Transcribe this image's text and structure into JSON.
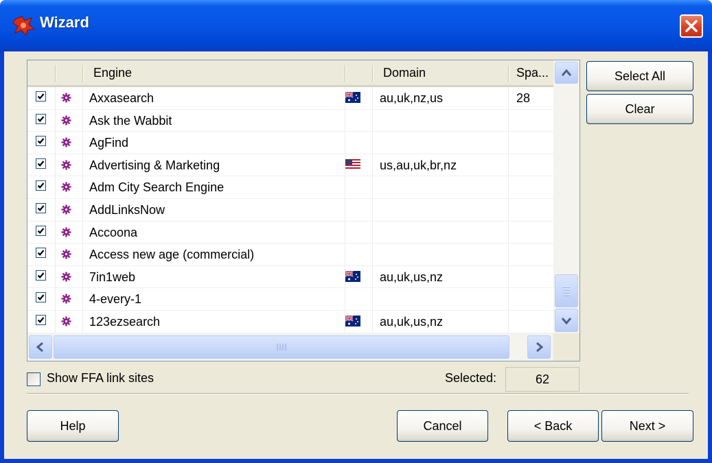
{
  "window": {
    "title": "Wizard",
    "accent_color": "#0054e3",
    "close_icon": "close-icon"
  },
  "list": {
    "columns": [
      "",
      "",
      "Engine",
      "",
      "Domain",
      "Spa..."
    ],
    "rows": [
      {
        "checked": true,
        "engine": "Axxasearch",
        "flag": "australia",
        "domain": "au,uk,nz,us",
        "spam": "28"
      },
      {
        "checked": true,
        "engine": "Ask the Wabbit",
        "flag": "",
        "domain": "",
        "spam": ""
      },
      {
        "checked": true,
        "engine": "AgFind",
        "flag": "",
        "domain": "",
        "spam": ""
      },
      {
        "checked": true,
        "engine": "Advertising & Marketing",
        "flag": "usa",
        "domain": "us,au,uk,br,nz",
        "spam": ""
      },
      {
        "checked": true,
        "engine": "Adm City Search Engine",
        "flag": "",
        "domain": "",
        "spam": ""
      },
      {
        "checked": true,
        "engine": "AddLinksNow",
        "flag": "",
        "domain": "",
        "spam": ""
      },
      {
        "checked": true,
        "engine": "Accoona",
        "flag": "",
        "domain": "",
        "spam": ""
      },
      {
        "checked": true,
        "engine": "Access new age (commercial)",
        "flag": "",
        "domain": "",
        "spam": ""
      },
      {
        "checked": true,
        "engine": "7in1web",
        "flag": "australia",
        "domain": "au,uk,us,nz",
        "spam": ""
      },
      {
        "checked": true,
        "engine": "4-every-1",
        "flag": "",
        "domain": "",
        "spam": ""
      },
      {
        "checked": true,
        "engine": "123ezsearch",
        "flag": "australia",
        "domain": "au,uk,us,nz",
        "spam": ""
      }
    ]
  },
  "buttons": {
    "select_all": "Select All",
    "clear": "Clear",
    "help": "Help",
    "cancel": "Cancel",
    "back": "< Back",
    "next": "Next >"
  },
  "options": {
    "show_ffa_label": "Show FFA link sites",
    "show_ffa_checked": false
  },
  "status": {
    "selected_label": "Selected:",
    "selected_count": "62"
  }
}
